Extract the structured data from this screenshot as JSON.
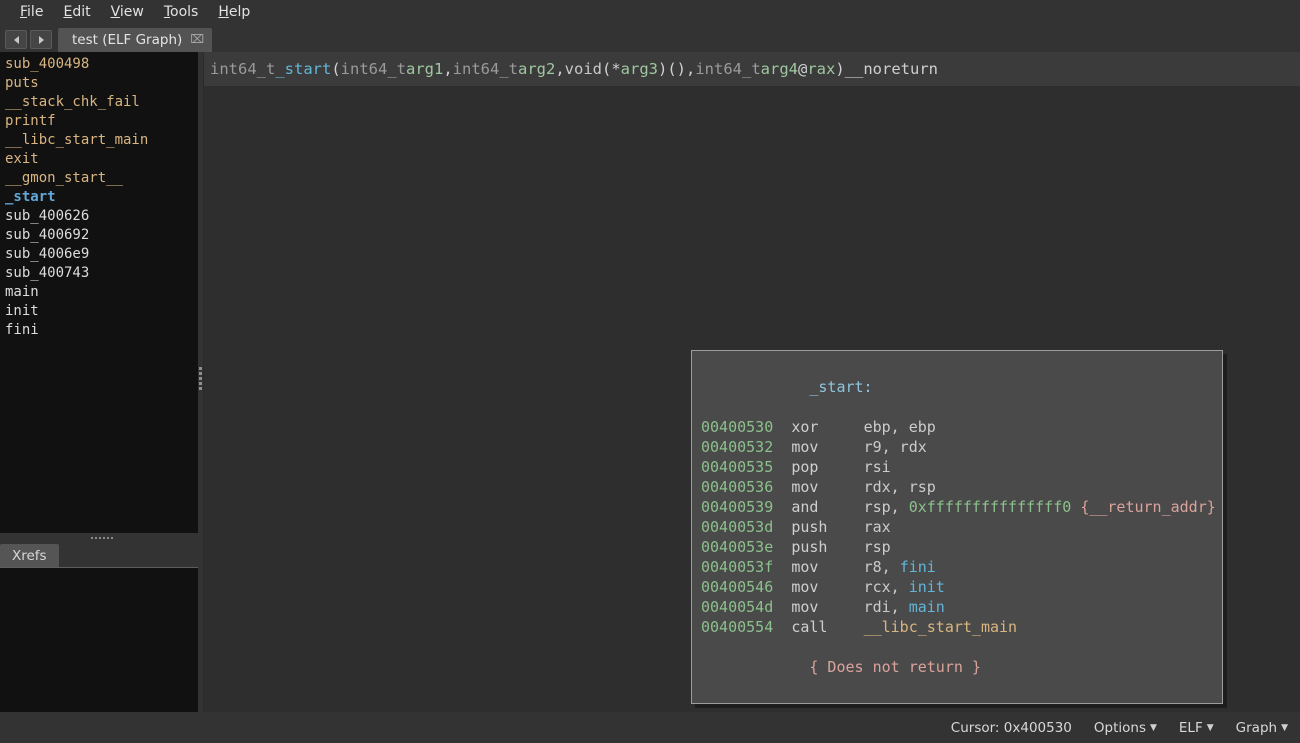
{
  "window": {
    "title": "test (ELF Graph)"
  },
  "menubar": {
    "items": [
      {
        "label": "File",
        "accel": "F",
        "rest": "ile"
      },
      {
        "label": "Edit",
        "accel": "E",
        "rest": "dit"
      },
      {
        "label": "View",
        "accel": "V",
        "rest": "iew"
      },
      {
        "label": "Tools",
        "accel": "T",
        "rest": "ools"
      },
      {
        "label": "Help",
        "accel": "H",
        "rest": "elp"
      }
    ]
  },
  "tabbar": {
    "back_icon": "arrow-left-icon",
    "forward_icon": "arrow-right-icon",
    "tab_label": "test (ELF Graph)",
    "close_icon": "close-icon",
    "close_glyph": "⌧"
  },
  "sidebar": {
    "symbols": [
      {
        "label": "sub_400498",
        "style": "import"
      },
      {
        "label": "puts",
        "style": "import"
      },
      {
        "label": "__stack_chk_fail",
        "style": "import"
      },
      {
        "label": "printf",
        "style": "import"
      },
      {
        "label": "__libc_start_main",
        "style": "import"
      },
      {
        "label": "exit",
        "style": "import"
      },
      {
        "label": "__gmon_start__",
        "style": "import"
      },
      {
        "label": "_start",
        "style": "selected"
      },
      {
        "label": "sub_400626",
        "style": "plain"
      },
      {
        "label": "sub_400692",
        "style": "plain"
      },
      {
        "label": "sub_4006e9",
        "style": "plain"
      },
      {
        "label": "sub_400743",
        "style": "plain"
      },
      {
        "label": "main",
        "style": "plain"
      },
      {
        "label": "init",
        "style": "plain"
      },
      {
        "label": "fini",
        "style": "plain"
      }
    ],
    "xrefs_tab_label": "Xrefs",
    "xrefs_content": ""
  },
  "function_header": {
    "tokens": [
      {
        "text": "int64_t",
        "cls": "t-type"
      },
      {
        "text": " ",
        "cls": "t-punct"
      },
      {
        "text": "_start",
        "cls": "t-func"
      },
      {
        "text": "(",
        "cls": "t-punct"
      },
      {
        "text": "int64_t",
        "cls": "t-type"
      },
      {
        "text": " ",
        "cls": "t-punct"
      },
      {
        "text": "arg1",
        "cls": "t-arg"
      },
      {
        "text": ", ",
        "cls": "t-punct"
      },
      {
        "text": "int64_t",
        "cls": "t-type"
      },
      {
        "text": " ",
        "cls": "t-punct"
      },
      {
        "text": "arg2",
        "cls": "t-arg"
      },
      {
        "text": ", ",
        "cls": "t-punct"
      },
      {
        "text": "void",
        "cls": "t-kw"
      },
      {
        "text": " (* ",
        "cls": "t-punct"
      },
      {
        "text": "arg3",
        "cls": "t-arg"
      },
      {
        "text": ")(), ",
        "cls": "t-punct"
      },
      {
        "text": "int64_t",
        "cls": "t-type"
      },
      {
        "text": " ",
        "cls": "t-punct"
      },
      {
        "text": "arg4",
        "cls": "t-arg"
      },
      {
        "text": " @ ",
        "cls": "t-punct"
      },
      {
        "text": "rax",
        "cls": "t-arg"
      },
      {
        "text": ") ",
        "cls": "t-punct"
      },
      {
        "text": "__noreturn",
        "cls": "t-annot"
      }
    ],
    "plain": "int64_t _start(int64_t arg1, int64_t arg2, void (* arg3)(), int64_t arg4 @ rax) __noreturn"
  },
  "graph": {
    "block": {
      "label": "_start:",
      "lines": [
        {
          "addr": "00400530",
          "mnemonic": "xor",
          "operands": [
            {
              "text": "ebp, ebp",
              "cls": "c-reg"
            }
          ]
        },
        {
          "addr": "00400532",
          "mnemonic": "mov",
          "operands": [
            {
              "text": "r9, rdx",
              "cls": "c-reg"
            }
          ]
        },
        {
          "addr": "00400535",
          "mnemonic": "pop",
          "operands": [
            {
              "text": "rsi",
              "cls": "c-reg"
            }
          ]
        },
        {
          "addr": "00400536",
          "mnemonic": "mov",
          "operands": [
            {
              "text": "rdx, rsp",
              "cls": "c-reg"
            }
          ]
        },
        {
          "addr": "00400539",
          "mnemonic": "and",
          "operands": [
            {
              "text": "rsp, ",
              "cls": "c-reg"
            },
            {
              "text": "0xfffffffffffffff0",
              "cls": "c-num"
            },
            {
              "text": " ",
              "cls": "c-reg"
            },
            {
              "text": "{__return_addr}",
              "cls": "c-comment"
            }
          ]
        },
        {
          "addr": "0040053d",
          "mnemonic": "push",
          "operands": [
            {
              "text": "rax",
              "cls": "c-reg"
            }
          ]
        },
        {
          "addr": "0040053e",
          "mnemonic": "push",
          "operands": [
            {
              "text": "rsp",
              "cls": "c-reg"
            }
          ]
        },
        {
          "addr": "0040053f",
          "mnemonic": "mov",
          "operands": [
            {
              "text": "r8, ",
              "cls": "c-reg"
            },
            {
              "text": "fini",
              "cls": "c-sym"
            }
          ]
        },
        {
          "addr": "00400546",
          "mnemonic": "mov",
          "operands": [
            {
              "text": "rcx, ",
              "cls": "c-reg"
            },
            {
              "text": "init",
              "cls": "c-sym"
            }
          ]
        },
        {
          "addr": "0040054d",
          "mnemonic": "mov",
          "operands": [
            {
              "text": "rdi, ",
              "cls": "c-reg"
            },
            {
              "text": "main",
              "cls": "c-sym"
            }
          ]
        },
        {
          "addr": "00400554",
          "mnemonic": "call",
          "operands": [
            {
              "text": "__libc_start_main",
              "cls": "c-import"
            }
          ]
        }
      ],
      "footer": "{ Does not return }"
    }
  },
  "statusbar": {
    "cursor": "Cursor: 0x400530",
    "options_label": "Options",
    "view_type_label": "ELF",
    "view_mode_label": "Graph",
    "caret_glyph": "▼"
  },
  "colors": {
    "window_bg": "#333333",
    "canvas_bg": "#2e2e2e",
    "panel_bg": "#111111",
    "block_bg": "#4a4a4a",
    "block_border": "#9d9d9d",
    "accent_symbol": "#62a8d8",
    "import_symbol": "#d8b581",
    "address_green": "#8cc08c",
    "comment_salmon": "#dba39c"
  }
}
